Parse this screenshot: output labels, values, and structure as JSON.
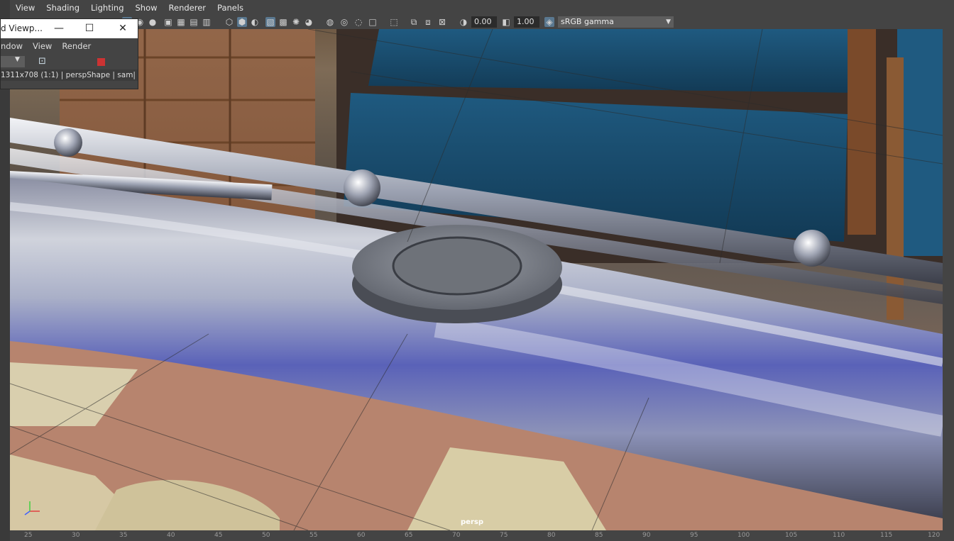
{
  "menubar": {
    "items": [
      "View",
      "Shading",
      "Lighting",
      "Show",
      "Renderer",
      "Panels"
    ]
  },
  "toolbar": {
    "exposure_value": "0.00",
    "gamma_value": "1.00",
    "color_space": "sRGB gamma"
  },
  "render_window": {
    "title": "d Viewp...",
    "menu_items": [
      "ndow",
      "View",
      "Render"
    ],
    "status": "1311x708 (1:1)  |  perspShape  |  sam|"
  },
  "viewport": {
    "camera_label": "persp"
  },
  "timeline": {
    "ticks": [
      "25",
      "30",
      "35",
      "40",
      "45",
      "50",
      "55",
      "60",
      "65",
      "70",
      "75",
      "80",
      "85",
      "90",
      "95",
      "100",
      "105",
      "110",
      "115",
      "120"
    ]
  },
  "colors": {
    "bench_blue": "#1f5f86",
    "rail_chrome": "#c8ccd8",
    "stop_record": "#cc3333",
    "active_icon": "#5a7890"
  }
}
